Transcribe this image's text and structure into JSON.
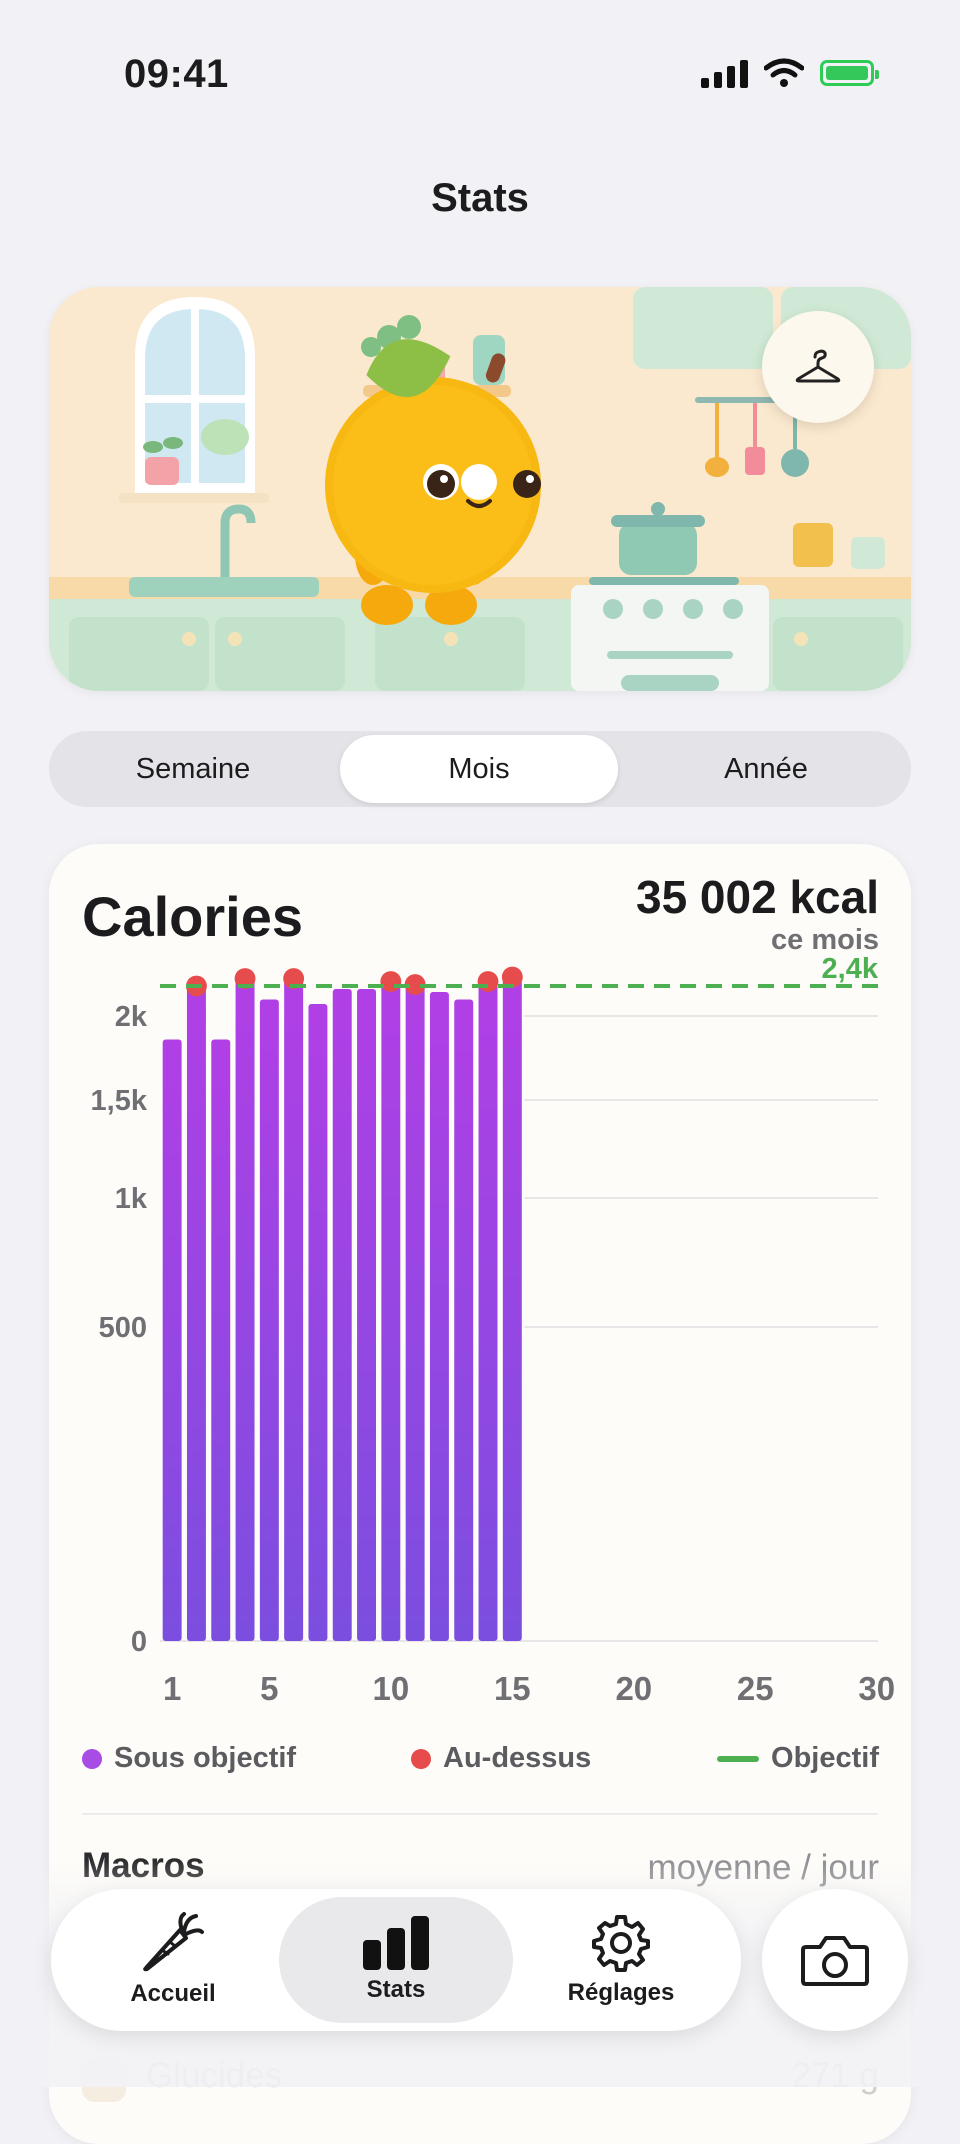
{
  "status_bar": {
    "time": "09:41"
  },
  "header": {
    "title": "Stats"
  },
  "hero": {
    "hanger_icon": "hanger-icon"
  },
  "segments": [
    {
      "label": "Semaine",
      "selected": false
    },
    {
      "label": "Mois",
      "selected": true
    },
    {
      "label": "Année",
      "selected": false
    }
  ],
  "calories": {
    "title": "Calories",
    "total": "35 002 kcal",
    "period": "ce mois",
    "goal_label": "2,4k"
  },
  "chart_data": {
    "type": "bar",
    "x": [
      1,
      2,
      3,
      4,
      5,
      6,
      7,
      8,
      9,
      10,
      11,
      12,
      13,
      14,
      15
    ],
    "values": [
      1860,
      2200,
      1860,
      2250,
      2110,
      2250,
      2080,
      2180,
      2180,
      2230,
      2210,
      2160,
      2110,
      2230,
      2260
    ],
    "above_goal": [
      false,
      true,
      false,
      true,
      false,
      true,
      false,
      false,
      false,
      true,
      true,
      false,
      false,
      true,
      true
    ],
    "goal": 2200,
    "xlim": [
      1,
      30
    ],
    "x_ticks": [
      "1",
      "5",
      "10",
      "15",
      "20",
      "25",
      "30"
    ],
    "y_ticks": [
      "0",
      "500",
      "1k",
      "1,5k",
      "2k"
    ],
    "y_tick_values": [
      0,
      500,
      1000,
      1500,
      2000
    ],
    "ymax": 2400,
    "colors": {
      "bar_top": "#b13fe6",
      "bar_bottom": "#7b4ee0",
      "over": "#e74c4c",
      "goal": "#4caf50"
    }
  },
  "legend": [
    {
      "label": "Sous objectif",
      "color": "#a94ce6"
    },
    {
      "label": "Au-dessus",
      "color": "#e74c4c"
    },
    {
      "label": "Objectif",
      "color": "#4caf50"
    }
  ],
  "macros": {
    "title": "Macros",
    "subtitle": "moyenne / jour"
  },
  "glucides": {
    "label": "Glucides",
    "value": "271 g"
  },
  "tabs": [
    {
      "label": "Accueil",
      "icon": "carrot-icon"
    },
    {
      "label": "Stats",
      "icon": "bar-chart-icon"
    },
    {
      "label": "Réglages",
      "icon": "gear-icon"
    }
  ],
  "camera": {
    "icon": "camera-icon"
  }
}
